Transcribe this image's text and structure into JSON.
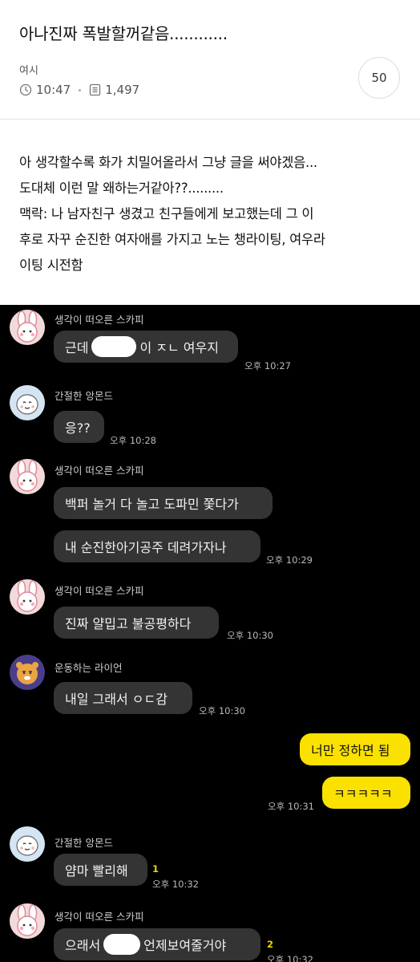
{
  "post": {
    "title": "아나진짜 폭발할꺼같음............",
    "board": "여시",
    "time": "10:47",
    "views": "1,497",
    "comment_count": "50",
    "body_lines": [
      "아 생각할수록 화가 치밀어올라서 그냥 글을 써야겠음...",
      "도대체 이런 말 왜하는거같아??.........",
      "맥락: 나 남자친구 생겼고 친구들에게 보고했는데 그 이",
      "후로 자꾸 순진한 여자애를 가지고 노는 챙라이팅, 여우라",
      "이팅 시전함"
    ]
  },
  "chat": {
    "senders": {
      "scarpy": "생각이 떠오른 스카피",
      "almond": "간절한 앙몬드",
      "ryan": "운동하는 라이언"
    },
    "messages": {
      "m1_pre": "근데",
      "m1_post": "이 ㅈㄴ 여우지",
      "m2": "응??",
      "m3": "백퍼 놀거 다 놀고 도파민 쫓다가",
      "m4": "내 순진한아기공주 데려가자나",
      "m5": "진짜 얄밉고 불공평하다",
      "m6": "내일 그래서 ㅇㄷ감",
      "m7": "너만 정하면 됨",
      "m8": "ㅋㅋㅋㅋㅋ",
      "m9": "얌마 빨리해",
      "m10_pre": "으래서",
      "m10_post": "언제보여줄거야"
    },
    "times": {
      "t1": "오후 10:27",
      "t2": "오후 10:28",
      "t3": "오후 10:29",
      "t4": "오후 10:30",
      "t5": "오후 10:30",
      "t6": "오후 10:31",
      "t7": "오후 10:32",
      "t8": "오후 10:32"
    },
    "unread": {
      "u1": "1",
      "u2": "2"
    }
  },
  "colors": {
    "chat_bg": "#000000",
    "bubble_other": "#343434",
    "bubble_mine": "#fae100",
    "unread": "#f2d100"
  },
  "icons": [
    "clock-icon",
    "document-icon"
  ]
}
